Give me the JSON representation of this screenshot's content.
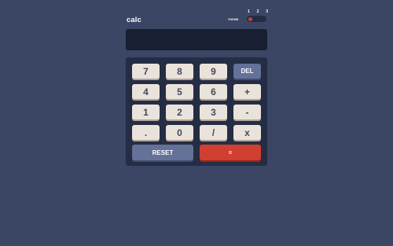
{
  "header": {
    "logo": "calc",
    "theme_label": "THEME",
    "theme_options": [
      "1",
      "2",
      "3"
    ],
    "theme_selected": 1
  },
  "screen": {
    "value": ""
  },
  "keys": {
    "k7": "7",
    "k8": "8",
    "k9": "9",
    "del": "DEL",
    "k4": "4",
    "k5": "5",
    "k6": "6",
    "plus": "+",
    "k1": "1",
    "k2": "2",
    "k3": "3",
    "minus": "-",
    "dot": ".",
    "k0": "0",
    "divide": "/",
    "multiply": "x",
    "reset": "RESET",
    "equals": "="
  },
  "colors": {
    "background": "#3b4664",
    "keypad": "#252d44",
    "screen": "#181f33",
    "key": "#eae3dc",
    "accent": "#647198",
    "equals": "#d13f30"
  }
}
